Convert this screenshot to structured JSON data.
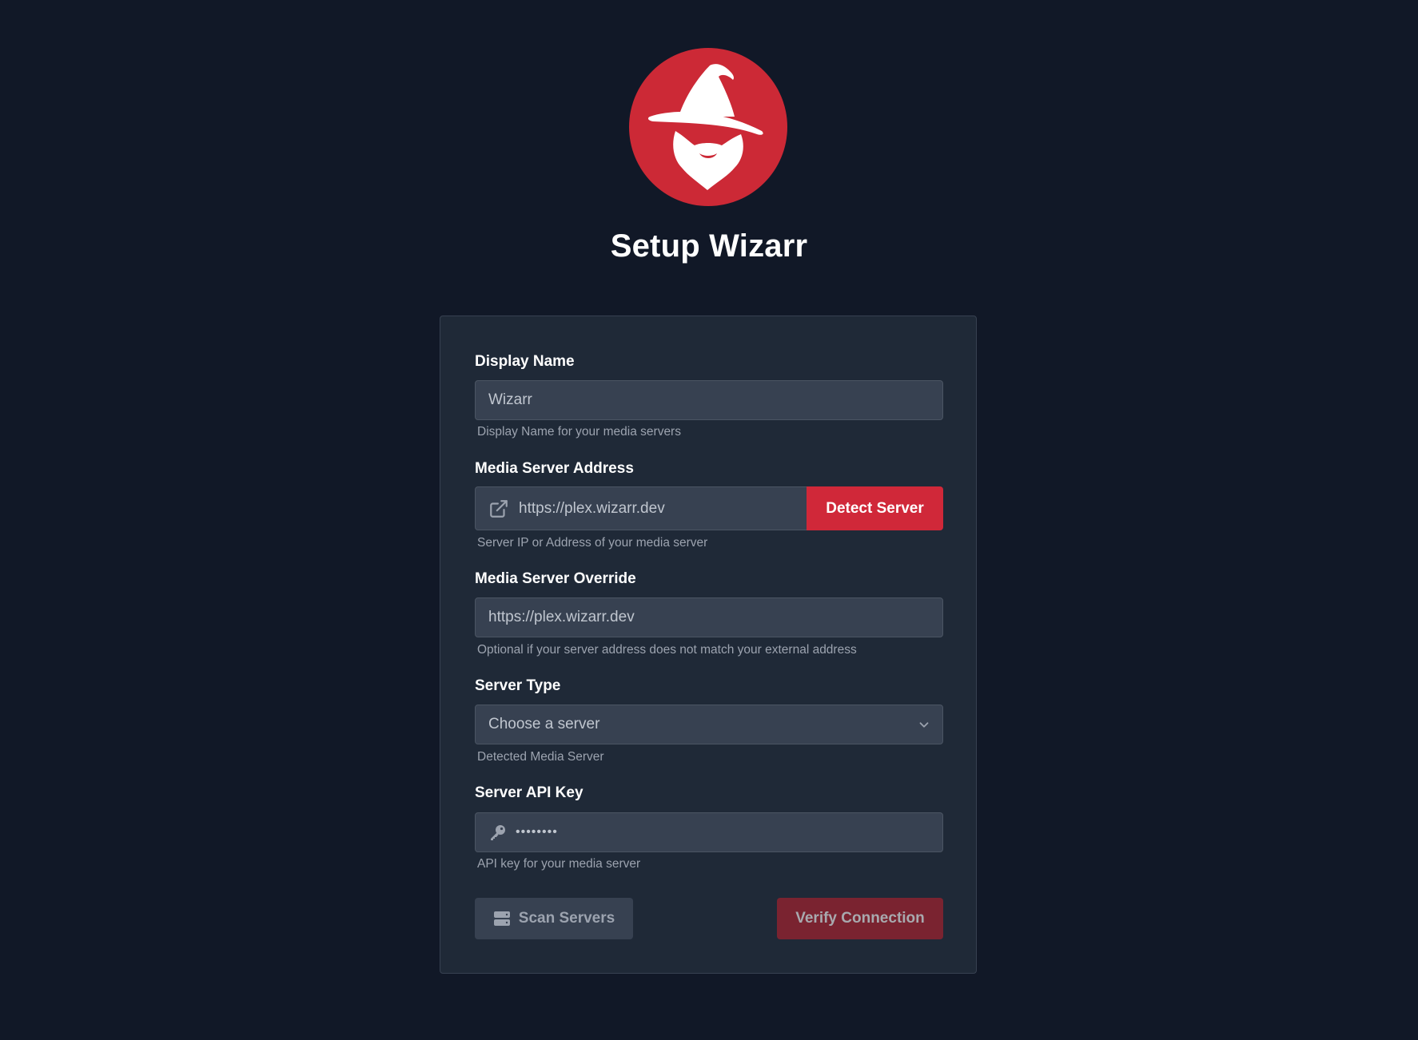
{
  "header": {
    "logo_icon": "wizard-logo-icon",
    "title": "Setup Wizarr"
  },
  "form": {
    "display_name": {
      "label": "Display Name",
      "value": "Wizarr",
      "help": "Display Name for your media servers"
    },
    "server_address": {
      "label": "Media Server Address",
      "icon": "external-link-icon",
      "value": "https://plex.wizarr.dev",
      "button": "Detect Server",
      "help": "Server IP or Address of your media server"
    },
    "server_override": {
      "label": "Media Server Override",
      "value": "https://plex.wizarr.dev",
      "help": "Optional if your server address does not match your external address"
    },
    "server_type": {
      "label": "Server Type",
      "selected": "Choose a server",
      "icon": "chevron-down-icon",
      "help": "Detected Media Server"
    },
    "api_key": {
      "label": "Server API Key",
      "icon": "key-icon",
      "masked_value": "••••••••",
      "help": "API key for your media server"
    },
    "actions": {
      "scan_label": "Scan Servers",
      "scan_icon": "server-icon",
      "verify_label": "Verify Connection"
    }
  },
  "colors": {
    "background": "#111827",
    "card": "#1f2937",
    "input": "#374151",
    "accent": "#d02839",
    "accent_disabled": "#7a2330"
  }
}
